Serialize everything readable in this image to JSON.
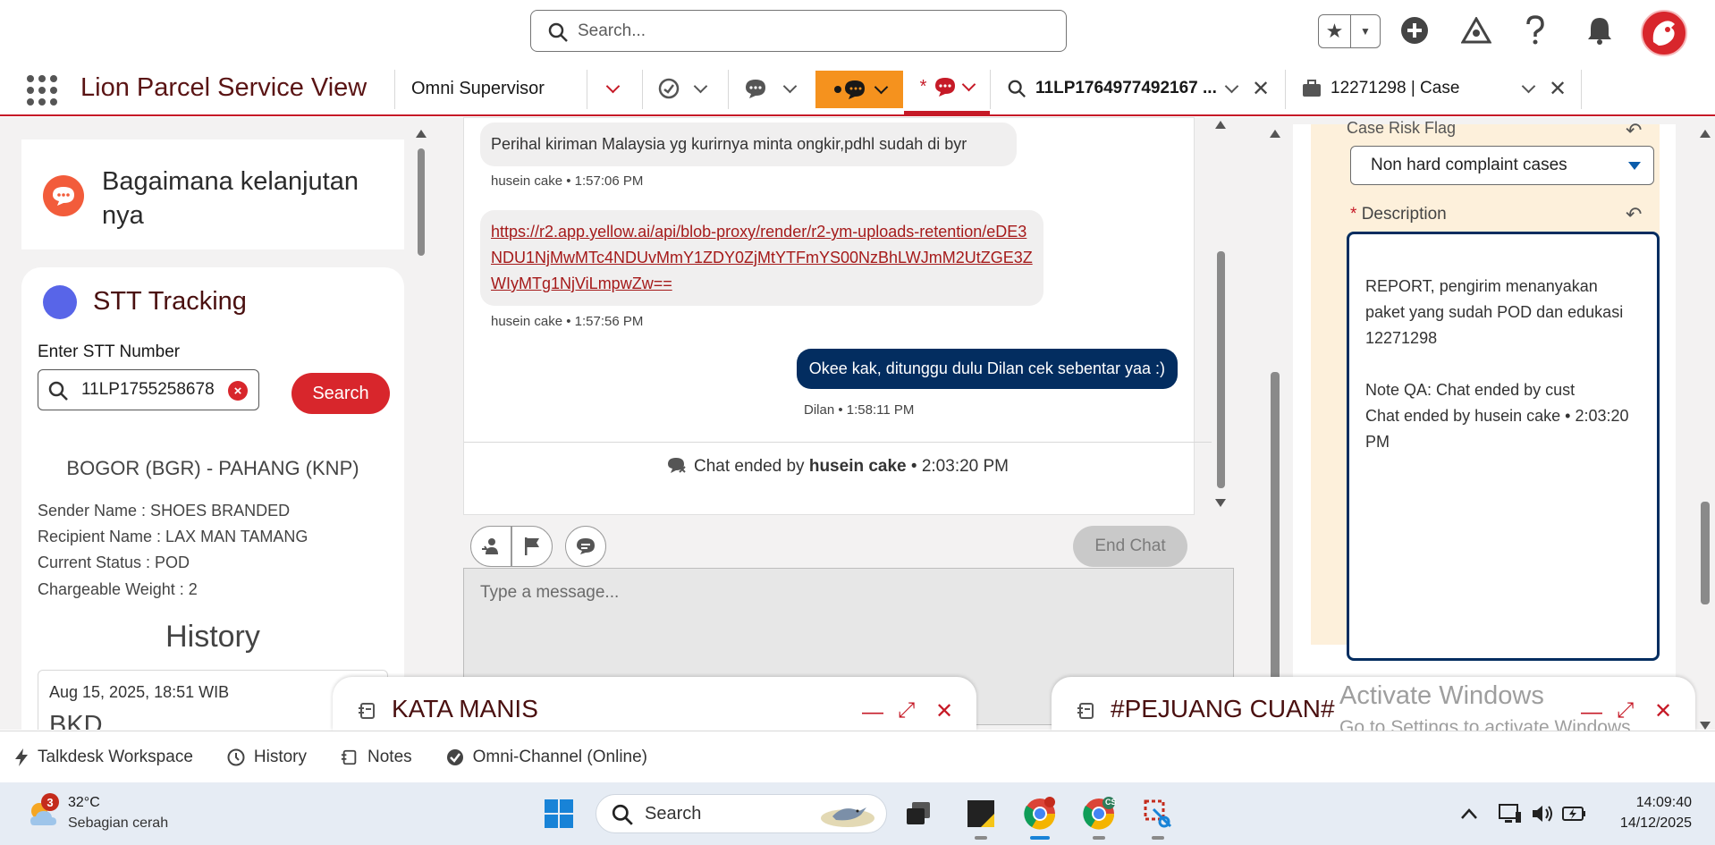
{
  "header": {
    "search_placeholder": "Search..."
  },
  "nav": {
    "app_name": "Lion Parcel Service View",
    "omni_tab": "Omni Supervisor",
    "search_tab": "11LP1764977492167 ...",
    "case_tab": "12271298 | Case"
  },
  "left_panel": {
    "card_title": "Bagaimana kelanjutan nya",
    "stt_title": "STT Tracking",
    "stt_label": "Enter STT Number",
    "stt_value": "11LP1755258678",
    "search_button": "Search",
    "route": "BOGOR (BGR) - PAHANG (KNP)",
    "sender": "Sender Name : SHOES BRANDED",
    "recipient": "Recipient Name : LAX MAN TAMANG",
    "status": "Current Status : POD",
    "weight": "Chargeable Weight : 2",
    "history_title": "History",
    "history_date": "Aug 15, 2025, 18:51 WIB",
    "history_code": "BKD"
  },
  "chat": {
    "msg1_text": "Perihal kiriman Malaysia yg kurirnya minta ongkir,pdhl sudah di byr",
    "msg1_meta": "husein cake • 1:57:06 PM",
    "msg2_link": "https://r2.app.yellow.ai/api/blob-proxy/render/r2-ym-uploads-retention/eDE3NDU1NjMwMTc4NDUvMmY1ZDY0ZjMtYTFmYS00NzBhLWJmM2UtZGE3ZWIyMTg1NjViLmpwZw==",
    "msg2_meta": "husein cake • 1:57:56 PM",
    "msg3_text": "Okee kak, ditunggu dulu Dilan cek sebentar yaa :)",
    "msg3_meta": "Dilan • 1:58:11 PM",
    "ended_prefix": "Chat ended by ",
    "ended_name": "husein cake",
    "ended_time": " • 2:03:20 PM",
    "end_chat_button": "End Chat",
    "input_placeholder": "Type a message..."
  },
  "case": {
    "flag_label": "Case Risk Flag",
    "flag_value": "Non hard complaint cases",
    "desc_required": "*",
    "desc_label": "Description",
    "desc_value": "REPORT, pengirim menanyakan paket yang sudah POD dan edukasi 12271298\n\nNote QA: Chat ended by cust\nChat ended by husein cake • 2:03:20 PM"
  },
  "docked": {
    "window1": "KATA MANIS",
    "window2": "#PEJUANG CUAN#"
  },
  "watermark": {
    "line1": "Activate Windows",
    "line2": "Go to Settings to activate Windows."
  },
  "utility_bar": {
    "item1": "Talkdesk Workspace",
    "item2": "History",
    "item3": "Notes",
    "item4": "Omni-Channel (Online)"
  },
  "taskbar": {
    "weather_badge": "3",
    "temperature": "32°C",
    "weather_desc": "Sebagian cerah",
    "search_label": "Search",
    "chrome_badge": "CS",
    "time": "14:09:40",
    "date": "14/12/2025"
  },
  "colors": {
    "brand_red": "#c61a27",
    "outgoing_bubble": "#032d60",
    "tab_orange": "#f5921e"
  }
}
